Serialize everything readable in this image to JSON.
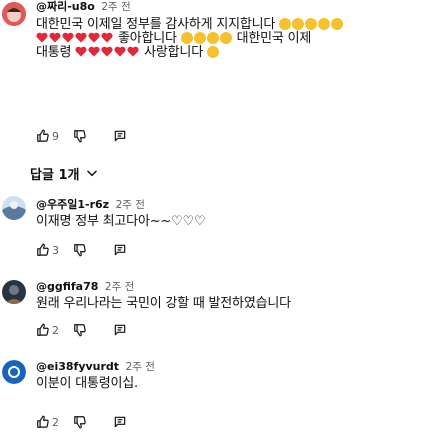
{
  "comments": [
    {
      "handle": "@짜리-u8o",
      "time": "2주 전",
      "text_line1": "대한민국 이제일 정부를 감사하게 지지합니다",
      "text_line2": "좋아합니다",
      "text_line3": "대한민국 이제",
      "text_line4": "대통령",
      "text_line5": "사랑합니다",
      "likes": "9",
      "avatar_color": "#e05a5a"
    },
    {
      "handle": "@우주일1-r6z",
      "time": "2주 전",
      "text": "이재명 정부 최고다아~~♡♡♡",
      "likes": "3",
      "avatar_color": "#7aa0c8"
    },
    {
      "handle": "@ggfifa78",
      "time": "2주 전",
      "text": "원래 우리나라는 국민이 강할 때 발전하였습니다",
      "likes": "2",
      "avatar_color": "#3a4a5a"
    },
    {
      "handle": "@ei38fyvurdt",
      "time": "2주 전",
      "text": "이분이 대통령이십.",
      "likes": "2",
      "avatar_color": "#1565c0"
    }
  ],
  "replies_toggle": {
    "label": "답글 1개"
  },
  "icons": {
    "like": "thumbs-up-icon",
    "dislike": "thumbs-down-icon",
    "reply": "reply-icon",
    "chevron": "chevron-down-icon"
  }
}
